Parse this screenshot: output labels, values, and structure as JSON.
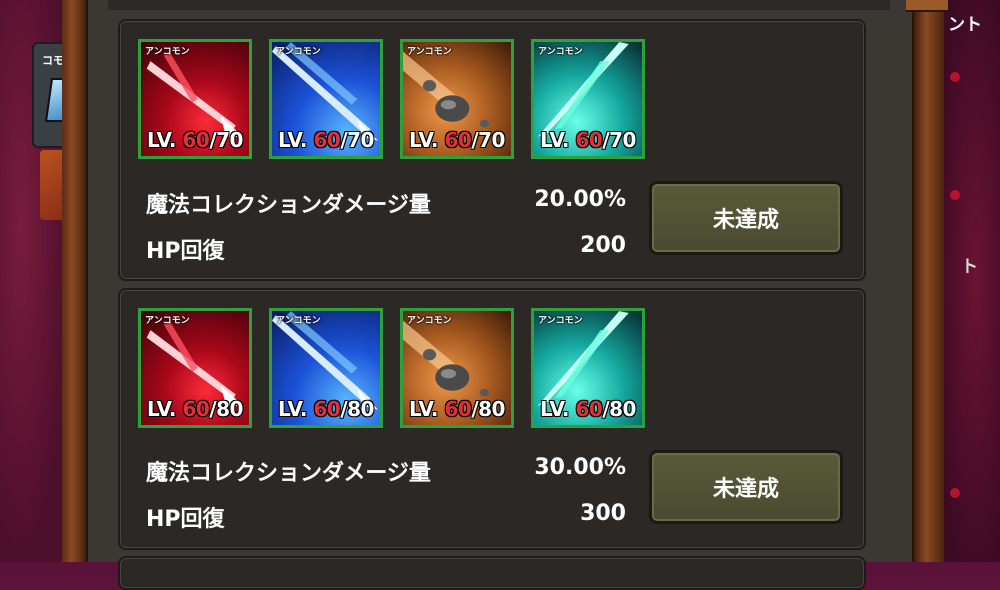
{
  "side": {
    "card_label": "コモ",
    "right_label_top": "ント",
    "right_label_mid": "ト"
  },
  "rows": [
    {
      "icons": [
        {
          "rarity": "アンコモン",
          "lv_prefix": "LV.",
          "lv_current": "60",
          "lv_max": "/70",
          "icon": "red-arrow-icon"
        },
        {
          "rarity": "アンコモン",
          "lv_prefix": "LV.",
          "lv_current": "60",
          "lv_max": "/70",
          "icon": "blue-spear-icon"
        },
        {
          "rarity": "アンコモン",
          "lv_prefix": "LV.",
          "lv_current": "60",
          "lv_max": "/70",
          "icon": "meteor-icon"
        },
        {
          "rarity": "アンコモン",
          "lv_prefix": "LV.",
          "lv_current": "60",
          "lv_max": "/70",
          "icon": "wind-blade-icon"
        }
      ],
      "stats": [
        {
          "label": "魔法コレクションダメージ量",
          "value": "20.00%"
        },
        {
          "label": "HP回復",
          "value": "200"
        }
      ],
      "button": "未達成"
    },
    {
      "icons": [
        {
          "rarity": "アンコモン",
          "lv_prefix": "LV.",
          "lv_current": "60",
          "lv_max": "/80",
          "icon": "red-arrow-icon"
        },
        {
          "rarity": "アンコモン",
          "lv_prefix": "LV.",
          "lv_current": "60",
          "lv_max": "/80",
          "icon": "blue-spear-icon"
        },
        {
          "rarity": "アンコモン",
          "lv_prefix": "LV.",
          "lv_current": "60",
          "lv_max": "/80",
          "icon": "meteor-icon"
        },
        {
          "rarity": "アンコモン",
          "lv_prefix": "LV.",
          "lv_current": "60",
          "lv_max": "/80",
          "icon": "wind-blade-icon"
        }
      ],
      "stats": [
        {
          "label": "魔法コレクションダメージ量",
          "value": "30.00%"
        },
        {
          "label": "HP回復",
          "value": "300"
        }
      ],
      "button": "未達成"
    }
  ],
  "colors": {
    "frame_green": "#2fa13a",
    "level_red": "#e0303a",
    "button_olive": "#4f4f34"
  }
}
